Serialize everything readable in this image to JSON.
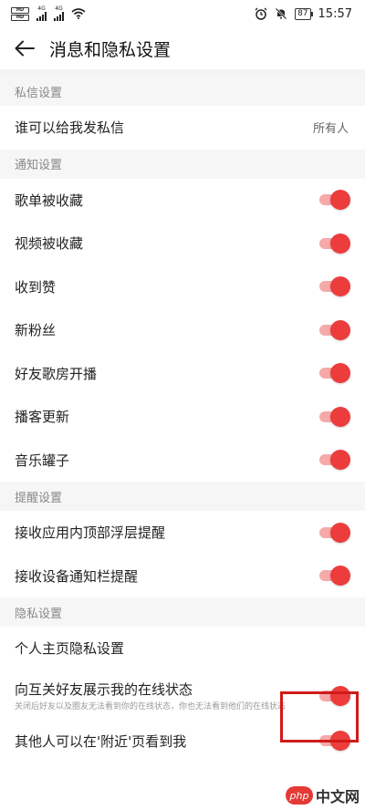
{
  "status_bar": {
    "sim1": "HD",
    "sim2": "HD",
    "net1": "4G",
    "net2": "4G",
    "battery": "87",
    "time": "15:57"
  },
  "nav": {
    "title": "消息和隐私设置"
  },
  "sections": {
    "private_msg": {
      "header": "私信设置",
      "who_can_message": {
        "label": "谁可以给我发私信",
        "value": "所有人"
      }
    },
    "notify": {
      "header": "通知设置",
      "items": [
        {
          "label": "歌单被收藏",
          "on": true
        },
        {
          "label": "视频被收藏",
          "on": true
        },
        {
          "label": "收到赞",
          "on": true
        },
        {
          "label": "新粉丝",
          "on": true
        },
        {
          "label": "好友歌房开播",
          "on": true
        },
        {
          "label": "播客更新",
          "on": true
        },
        {
          "label": "音乐罐子",
          "on": true
        }
      ]
    },
    "remind": {
      "header": "提醒设置",
      "items": [
        {
          "label": "接收应用内顶部浮层提醒",
          "on": true
        },
        {
          "label": "接收设备通知栏提醒",
          "on": true
        }
      ]
    },
    "privacy": {
      "header": "隐私设置",
      "homepage": {
        "label": "个人主页隐私设置"
      },
      "online_status": {
        "label": "向互关好友展示我的在线状态",
        "desc": "关闭后好友以及圈友无法看到你的在线状态，你也无法看到他们的在线状态",
        "on": true
      },
      "nearby": {
        "label": "其他人可以在'附近'页看到我",
        "on": true
      }
    }
  },
  "watermark": {
    "logo": "php",
    "text": "中文网"
  },
  "colors": {
    "accent": "#ec3c3c",
    "track": "#f5a9a9",
    "highlight": "#d11a1a"
  }
}
